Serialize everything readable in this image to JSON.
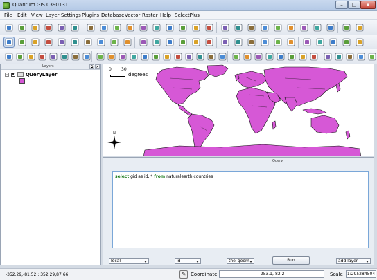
{
  "window": {
    "title": "Quantum GIS 0390131",
    "min_label": "–",
    "max_label": "□",
    "close_label": "x"
  },
  "menu": [
    "File",
    "Edit",
    "View",
    "Layer",
    "Settings",
    "Plugins",
    "Database",
    "Vector",
    "Raster",
    "Help",
    "SelectPlus"
  ],
  "layers_panel": {
    "title": "Layers",
    "float_label": "⧉",
    "close_label": "×",
    "layer_name": "QueryLayer",
    "checked_mark": "x",
    "expanded_mark": "-",
    "fill_color": "#d658d6"
  },
  "map": {
    "scale_start": "0",
    "scale_end": "30",
    "scale_unit": "degrees",
    "north_label": "N",
    "land_color": "#d658d6"
  },
  "query_panel": {
    "title": "Query",
    "sql": {
      "kw1": "select",
      "t1": " gid as id, * ",
      "kw2": "from",
      "t2": " naturalearth.countries"
    },
    "connection": "local",
    "id_column": "id",
    "geom_column": "the_geom",
    "run_label": "Run",
    "add_layer": "add layer"
  },
  "status": {
    "cursor_coords": "-352.29,-81.52 : 352.29,87.66",
    "coordinate_label": "Coordinate:",
    "coordinate_value": "-253.1,-82.2",
    "scale_label": "Scale",
    "scale_value": "1:295284504"
  },
  "colors": {
    "accent": "#d658d6",
    "keyword": "#1a7a1a",
    "editor_border": "#7aa7d8"
  },
  "toolbar_row1_icons": [
    "new-project-icon",
    "open-project-icon",
    "save-project-icon",
    "save-as-icon",
    "print-composer-icon",
    "composer-manager-icon",
    "digitize-icon",
    "save-edits-icon",
    "add-feature-icon",
    "move-feature-icon",
    "node-tool-icon",
    "delete-selected-icon",
    "cut-features-icon",
    "copy-features-icon",
    "paste-features-icon",
    "add-vector-icon",
    "add-raster-icon",
    "add-postgis-icon",
    "add-spatialite-icon",
    "add-mssql-icon",
    "add-wms-icon",
    "add-wcs-icon",
    "add-wfs-icon",
    "new-shapefile-icon",
    "new-spatialite-icon",
    "remove-layer-icon",
    "help-icon"
  ],
  "toolbar_row2_icons": [
    "pan-icon",
    "pan-to-selection-icon",
    "zoom-in-icon",
    "zoom-out-icon",
    "zoom-full-icon",
    "zoom-selection-icon",
    "zoom-layer-icon",
    "zoom-actual-icon",
    "zoom-last-icon",
    "zoom-next-icon",
    "refresh-icon",
    "identify-icon",
    "select-icon",
    "deselect-icon",
    "attribute-table-icon",
    "measure-icon",
    "map-tips-icon",
    "new-bookmark-icon",
    "show-bookmarks-icon",
    "text-annotation-icon",
    "label-icon",
    "python-icon",
    "settings-icon",
    "raster-icon",
    "vector-icon",
    "gps-icon",
    "other-icon"
  ],
  "toolbar_row3_icons": [
    "coordinate-capture-icon",
    "georeferencer-icon",
    "grid-icon",
    "georef-icon",
    "label-tool-icon",
    "digitize-leaf-icon",
    "query-icon",
    "metasearch-icon",
    "globe-icon",
    "heatmap-icon",
    "roadgraph-icon",
    "interpolation-icon",
    "spit-icon",
    "analysis-icon",
    "topology-icon",
    "zonal-stats-icon",
    "r-icon",
    "rotate-icon",
    "reload-icon",
    "sextante-icon",
    "help-tool-icon",
    "abc-icon",
    "plus-icon",
    "flag-icon",
    "pin-icon",
    "chart-icon",
    "grass-icon",
    "delete-icon",
    "node-icon",
    "link-icon",
    "color-icon",
    "ruler-icon",
    "pencil-icon"
  ]
}
